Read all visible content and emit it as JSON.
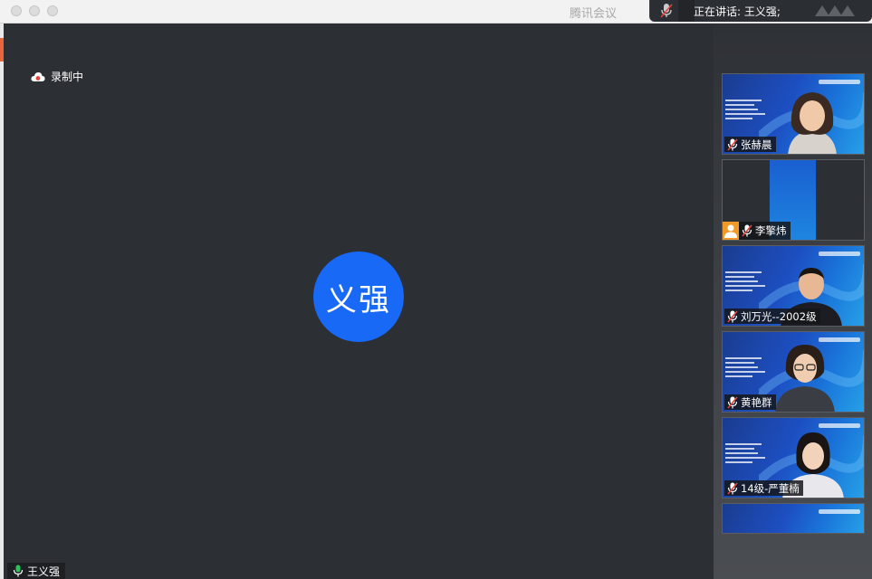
{
  "window": {
    "app_title": "腾讯会议"
  },
  "speaking": {
    "text": "正在讲话: 王义强;"
  },
  "main": {
    "recording_label": "录制中",
    "avatar_text": "义强",
    "self_name": "王义强"
  },
  "participants": [
    {
      "name": "张赫晨",
      "muted": true
    },
    {
      "name": "李擎炜",
      "muted": true,
      "has_user_icon": true
    },
    {
      "name": "刘万光--2002级",
      "muted": true
    },
    {
      "name": "黄艳群",
      "muted": true
    },
    {
      "name": "14级-严董楠",
      "muted": true
    }
  ],
  "colors": {
    "stage_bg": "#2c2f34",
    "avatar_blue": "#1769f6",
    "mic_green": "#2fc25b",
    "mute_red": "#e5443a",
    "user_icon_orange": "#f09a2a"
  }
}
